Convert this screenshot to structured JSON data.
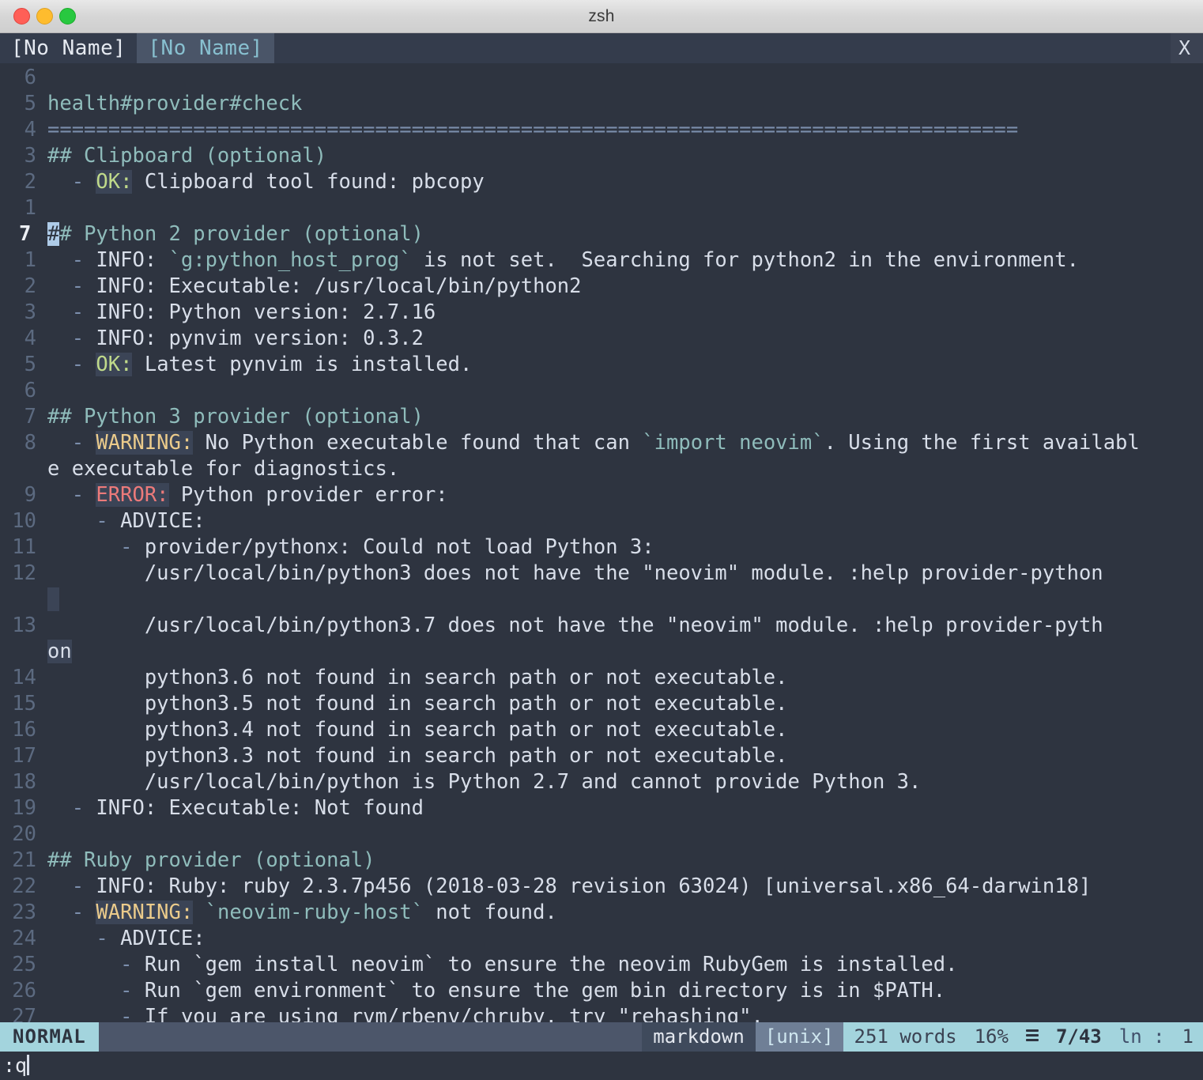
{
  "window": {
    "title": "zsh",
    "traffic_lights": [
      "close",
      "minimize",
      "zoom"
    ]
  },
  "tabline": {
    "tabs": [
      {
        "label": "[No Name]",
        "active": false
      },
      {
        "label": "[No Name]",
        "active": true
      }
    ],
    "close_label": "X"
  },
  "editor": {
    "current_line_number": "7",
    "lines": [
      {
        "num": "6",
        "segments": []
      },
      {
        "num": "5",
        "segments": [
          {
            "t": "health#provider#check",
            "c": "h"
          }
        ]
      },
      {
        "num": "4",
        "segments": [
          {
            "t": "================================================================================",
            "c": "rule"
          }
        ]
      },
      {
        "num": "3",
        "segments": [
          {
            "t": "## Clipboard (optional)",
            "c": "h"
          }
        ]
      },
      {
        "num": "2",
        "segments": [
          {
            "t": "  - ",
            "c": "bullet"
          },
          {
            "t": "OK:",
            "c": "ok"
          },
          {
            "t": " Clipboard tool found: pbcopy",
            "c": ""
          }
        ]
      },
      {
        "num": "1",
        "segments": []
      },
      {
        "num": "7",
        "cur": true,
        "segments": [
          {
            "t": "#",
            "c": "cursor"
          },
          {
            "t": "# Python 2 provider (optional)",
            "c": "h"
          }
        ]
      },
      {
        "num": "1",
        "segments": [
          {
            "t": "  - ",
            "c": "bullet"
          },
          {
            "t": "INFO: ",
            "c": ""
          },
          {
            "t": "`g:python_host_prog`",
            "c": "code"
          },
          {
            "t": " is not set.  Searching for python2 in the environment.",
            "c": ""
          }
        ]
      },
      {
        "num": "2",
        "segments": [
          {
            "t": "  - ",
            "c": "bullet"
          },
          {
            "t": "INFO: Executable: /usr/local/bin/python2",
            "c": ""
          }
        ]
      },
      {
        "num": "3",
        "segments": [
          {
            "t": "  - ",
            "c": "bullet"
          },
          {
            "t": "INFO: Python version: 2.7.16",
            "c": ""
          }
        ]
      },
      {
        "num": "4",
        "segments": [
          {
            "t": "  - ",
            "c": "bullet"
          },
          {
            "t": "INFO: pynvim version: 0.3.2",
            "c": ""
          }
        ]
      },
      {
        "num": "5",
        "segments": [
          {
            "t": "  - ",
            "c": "bullet"
          },
          {
            "t": "OK:",
            "c": "ok"
          },
          {
            "t": " Latest pynvim is installed.",
            "c": ""
          }
        ]
      },
      {
        "num": "6",
        "segments": []
      },
      {
        "num": "7",
        "segments": [
          {
            "t": "## Python 3 provider (optional)",
            "c": "h"
          }
        ]
      },
      {
        "num": "8",
        "segments": [
          {
            "t": "  - ",
            "c": "bullet"
          },
          {
            "t": "WARNING:",
            "c": "warn"
          },
          {
            "t": " No Python executable found that can ",
            "c": ""
          },
          {
            "t": "`import neovim`",
            "c": "code"
          },
          {
            "t": ". Using the first availabl",
            "c": ""
          }
        ]
      },
      {
        "num": "",
        "wrap": true,
        "segments": [
          {
            "t": "e executable for diagnostics.",
            "c": ""
          }
        ]
      },
      {
        "num": "9",
        "segments": [
          {
            "t": "  - ",
            "c": "bullet"
          },
          {
            "t": "ERROR:",
            "c": "err"
          },
          {
            "t": " Python provider error:",
            "c": ""
          }
        ]
      },
      {
        "num": "10",
        "segments": [
          {
            "t": "    - ",
            "c": "bullet"
          },
          {
            "t": "ADVICE:",
            "c": ""
          }
        ]
      },
      {
        "num": "11",
        "segments": [
          {
            "t": "      - ",
            "c": "bullet"
          },
          {
            "t": "provider/pythonx: Could not load Python 3:",
            "c": ""
          }
        ]
      },
      {
        "num": "12",
        "segments": [
          {
            "t": "        /usr/local/bin/python3 does not have the \"neovim\" module. :help provider-python",
            "c": ""
          }
        ]
      },
      {
        "num": "",
        "wrap": true,
        "wrapmark": true,
        "segments": []
      },
      {
        "num": "13",
        "segments": [
          {
            "t": "        /usr/local/bin/python3.7 does not have the \"neovim\" module. :help provider-pyth",
            "c": ""
          }
        ]
      },
      {
        "num": "",
        "wrap": true,
        "wrapmark": true,
        "segments": [
          {
            "t": "on",
            "c": "wrapmk"
          }
        ]
      },
      {
        "num": "14",
        "segments": [
          {
            "t": "        python3.6 not found in search path or not executable.",
            "c": ""
          }
        ]
      },
      {
        "num": "15",
        "segments": [
          {
            "t": "        python3.5 not found in search path or not executable.",
            "c": ""
          }
        ]
      },
      {
        "num": "16",
        "segments": [
          {
            "t": "        python3.4 not found in search path or not executable.",
            "c": ""
          }
        ]
      },
      {
        "num": "17",
        "segments": [
          {
            "t": "        python3.3 not found in search path or not executable.",
            "c": ""
          }
        ]
      },
      {
        "num": "18",
        "segments": [
          {
            "t": "        /usr/local/bin/python is Python 2.7 and cannot provide Python 3.",
            "c": ""
          }
        ]
      },
      {
        "num": "19",
        "segments": [
          {
            "t": "  - ",
            "c": "bullet"
          },
          {
            "t": "INFO: Executable: Not found",
            "c": ""
          }
        ]
      },
      {
        "num": "20",
        "segments": []
      },
      {
        "num": "21",
        "segments": [
          {
            "t": "## Ruby provider (optional)",
            "c": "h"
          }
        ]
      },
      {
        "num": "22",
        "segments": [
          {
            "t": "  - ",
            "c": "bullet"
          },
          {
            "t": "INFO: Ruby: ruby 2.3.7p456 (2018-03-28 revision 63024) [universal.x86_64-darwin18]",
            "c": ""
          }
        ]
      },
      {
        "num": "23",
        "segments": [
          {
            "t": "  - ",
            "c": "bullet"
          },
          {
            "t": "WARNING:",
            "c": "warn"
          },
          {
            "t": " ",
            "c": ""
          },
          {
            "t": "`neovim-ruby-host`",
            "c": "code"
          },
          {
            "t": " not found.",
            "c": ""
          }
        ]
      },
      {
        "num": "24",
        "segments": [
          {
            "t": "    - ",
            "c": "bullet"
          },
          {
            "t": "ADVICE:",
            "c": ""
          }
        ]
      },
      {
        "num": "25",
        "segments": [
          {
            "t": "      - ",
            "c": "bullet"
          },
          {
            "t": "Run `gem install neovim` to ensure the neovim RubyGem is installed.",
            "c": ""
          }
        ]
      },
      {
        "num": "26",
        "segments": [
          {
            "t": "      - ",
            "c": "bullet"
          },
          {
            "t": "Run `gem environment` to ensure the gem bin directory is in $PATH.",
            "c": ""
          }
        ]
      },
      {
        "num": "27",
        "segments": [
          {
            "t": "      - ",
            "c": "bullet"
          },
          {
            "t": "If you are using rvm/rbenv/chruby, try \"rehashing\".",
            "c": ""
          }
        ]
      }
    ]
  },
  "statusline": {
    "mode": "NORMAL",
    "filetype": "markdown",
    "fileformat": "[unix]",
    "wordcount": "251 words",
    "percent": "16%",
    "position": "7/43",
    "line_label": "ln :",
    "column": "1"
  },
  "cmdline": {
    "text": ":q"
  },
  "colors": {
    "background": "#2e3440",
    "foreground": "#d8dee9",
    "heading": "#8fbcbb",
    "accent": "#a3d4dd",
    "ok": "#bfd98a",
    "warning": "#ebcb8b",
    "error": "#ec7a7a",
    "cursor": "#aecbe8",
    "linenr": "#5c6a80"
  }
}
